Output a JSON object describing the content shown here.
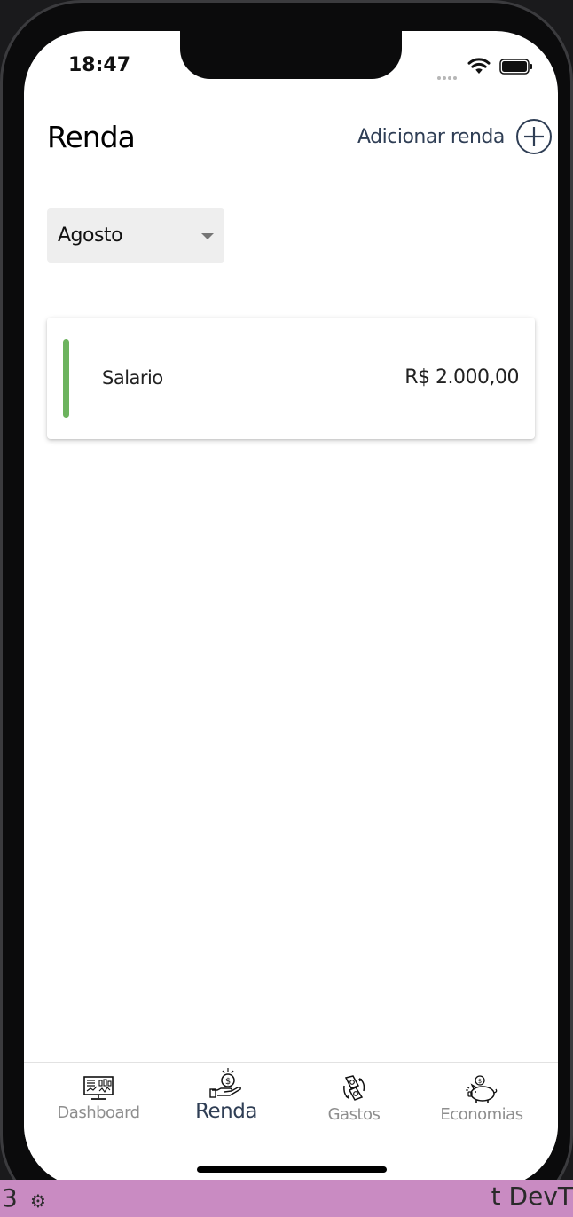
{
  "status_bar": {
    "time": "18:47"
  },
  "header": {
    "title": "Renda",
    "add_label": "Adicionar renda"
  },
  "month_selector": {
    "selected": "Agosto"
  },
  "incomes": [
    {
      "name": "Salario",
      "value": "R$ 2.000,00",
      "accent_color": "#6db35e"
    }
  ],
  "tabs": [
    {
      "label": "Dashboard",
      "icon": "dashboard-monitor-icon",
      "active": false
    },
    {
      "label": "Renda",
      "icon": "hand-coin-icon",
      "active": true
    },
    {
      "label": "Gastos",
      "icon": "money-exchange-icon",
      "active": false
    },
    {
      "label": "Economias",
      "icon": "piggy-bank-icon",
      "active": false
    }
  ],
  "colors": {
    "accent": "#2f3e55",
    "income_bar": "#6db35e",
    "inactive_tab": "#8e8e8e"
  },
  "taskbar": {
    "left_text": "3",
    "right_text": "t DevT"
  }
}
